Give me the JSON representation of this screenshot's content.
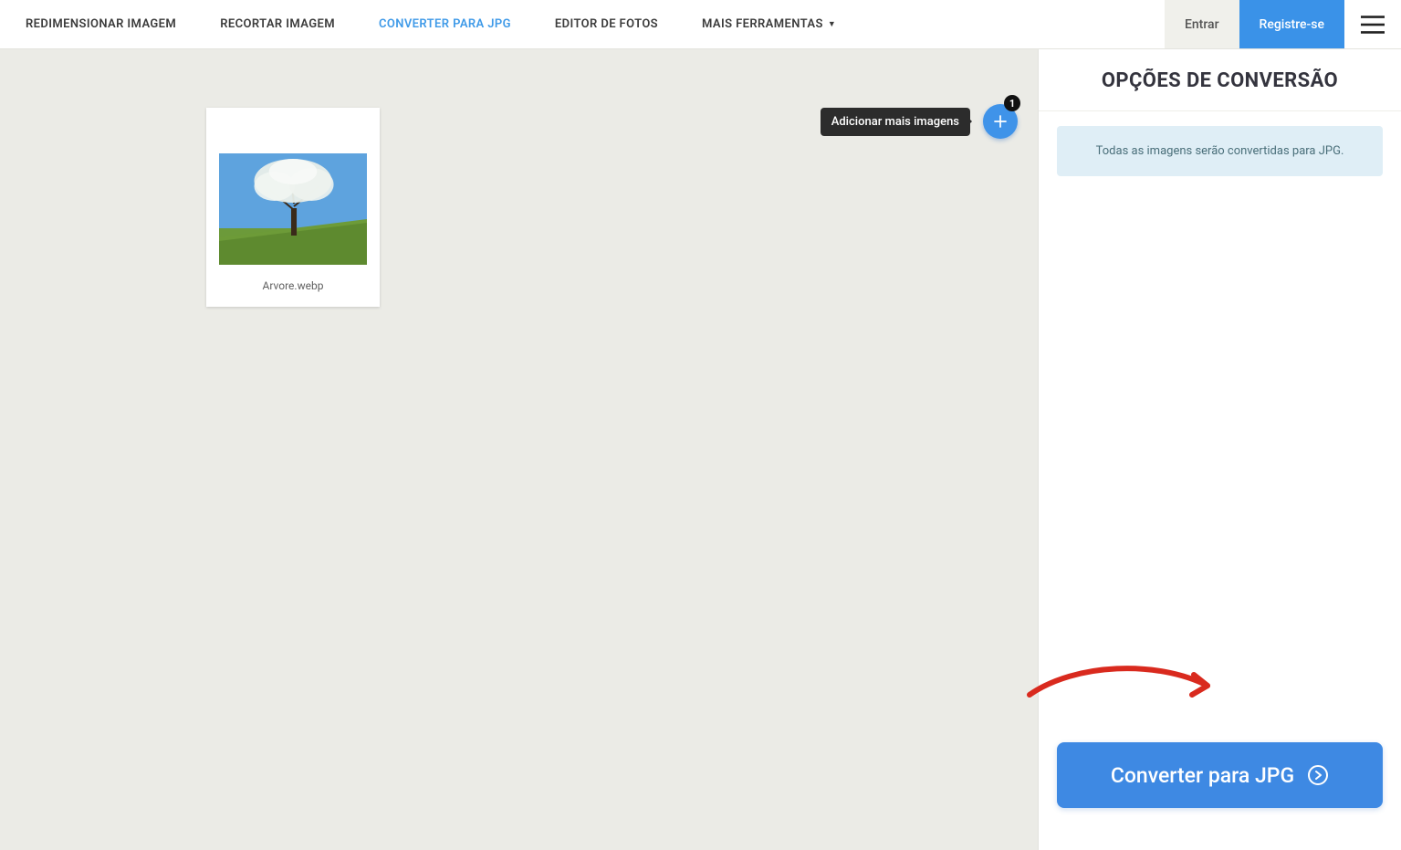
{
  "nav": {
    "resize": "REDIMENSIONAR IMAGEM",
    "crop": "RECORTAR IMAGEM",
    "convert": "CONVERTER PARA JPG",
    "editor": "EDITOR DE FOTOS",
    "more": "MAIS FERRAMENTAS"
  },
  "auth": {
    "login": "Entrar",
    "register": "Registre-se"
  },
  "canvas": {
    "thumbnail_filename": "Arvore.webp",
    "add_more_label": "Adicionar mais imagens",
    "add_badge_count": "1"
  },
  "sidebar": {
    "title": "OPÇÕES DE CONVERSÃO",
    "info_message": "Todas as imagens serão convertidas para JPG.",
    "convert_button": "Converter para JPG"
  }
}
